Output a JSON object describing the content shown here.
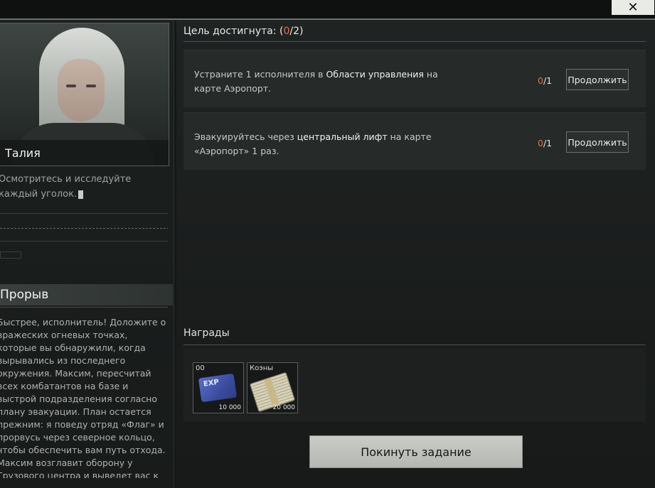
{
  "window": {
    "close_label": "✕"
  },
  "character": {
    "name": "Талия",
    "intro": "Осмотритесь и исследуйте каждый уголок."
  },
  "mission": {
    "title": "Прорыв",
    "story": "Быстрее, исполнитель! Доложите о вражеских огневых точках, которые вы обнаружили, когда вырывались из последнего окружения. Максим, пересчитай всех комбатантов на базе и выстрой подразделения согласно плану эвакуации. План остается прежним: я поведу отряд «Флаг» и прорвусь через северное кольцо, чтобы обеспечить вам путь отхода. Максим возглавит оборону у Грузового центра и выведет вас к нашим ребятам, которые держат"
  },
  "objectives": {
    "header_prefix": "Цель достигнута: (",
    "done": "0",
    "header_suffix": "/2)",
    "items": [
      {
        "text_pre": "Устраните 1 исполнителя в ",
        "text_bold": "Области управления",
        "text_post": " на карте Аэропорт.",
        "progress": "0",
        "total": "/1",
        "button": "Продолжить"
      },
      {
        "text_pre": "Эвакуируйтесь через ",
        "text_bold": "центральный лифт",
        "text_post": " на карте «Аэропорт» 1 раз.",
        "progress": "0",
        "total": "/1",
        "button": "Продолжить"
      }
    ]
  },
  "rewards": {
    "title": "Награды",
    "items": [
      {
        "label": "00",
        "icon": "exp-card-icon",
        "amount": "10 000",
        "card_text": "EXP"
      },
      {
        "label": "Коэны",
        "icon": "cash-stack-icon",
        "amount": "20 000"
      }
    ]
  },
  "actions": {
    "leave": "Покинуть задание"
  }
}
